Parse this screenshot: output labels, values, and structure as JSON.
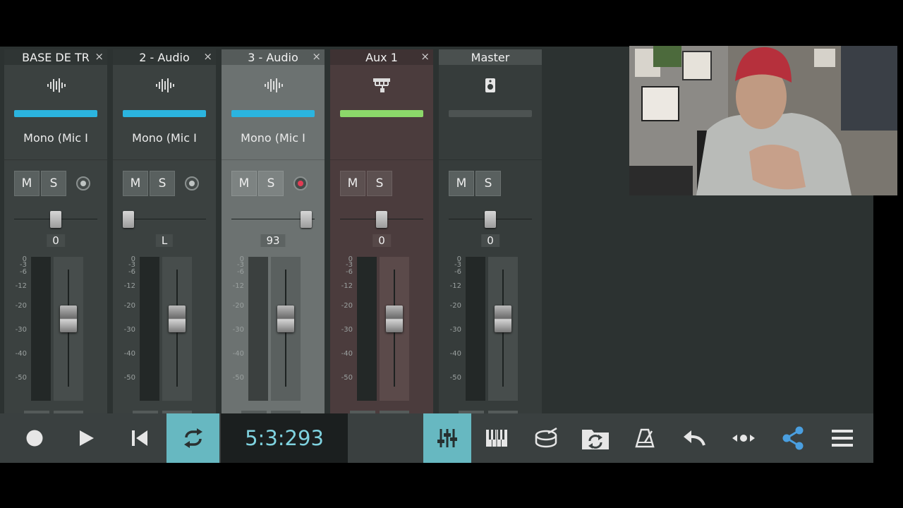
{
  "channels": [
    {
      "name": "BASE DE TR",
      "close": "×",
      "icon": "waveform-icon",
      "color": "#2bb4df",
      "input": "Mono (Mic I",
      "mute": "M",
      "solo": "S",
      "rec": "idle",
      "pan_label": "0",
      "pan_value": 0.5,
      "fader_db": 0
    },
    {
      "name": "2 - Audio",
      "close": "×",
      "icon": "waveform-icon",
      "color": "#2bb4df",
      "input": "Mono (Mic I",
      "mute": "M",
      "solo": "S",
      "rec": "idle",
      "pan_label": "L",
      "pan_value": 0.0,
      "fader_db": 0
    },
    {
      "name": "3 - Audio",
      "close": "×",
      "icon": "waveform-icon",
      "color": "#2bb4df",
      "input": "Mono (Mic I",
      "mute": "M",
      "solo": "S",
      "rec": "armed",
      "pan_label": "93",
      "pan_value": 0.965,
      "fader_db": 0
    },
    {
      "name": "Aux 1",
      "close": "×",
      "icon": "aux-bus-icon",
      "color": "#8cd86a",
      "mute": "M",
      "solo": "S",
      "pan_label": "0",
      "pan_value": 0.5,
      "fader_db": 0
    },
    {
      "name": "Master",
      "icon": "speaker-icon",
      "color": "#4d5352",
      "mute": "M",
      "solo": "S",
      "pan_label": "0",
      "pan_value": 0.5,
      "fader_db": 0
    }
  ],
  "meter_scale": [
    "0",
    "-3",
    "-6",
    "-12",
    "-20",
    "-30",
    "-40",
    "-50"
  ],
  "transport": {
    "time": "5:3:293",
    "record_icon": "record-icon",
    "play_icon": "play-icon",
    "rewind_icon": "skip-to-start-icon",
    "loop_icon": "loop-icon",
    "loop_active": true
  },
  "toolbar_right": [
    {
      "icon": "mixer-icon",
      "active": true
    },
    {
      "icon": "piano-keyboard-icon",
      "active": false
    },
    {
      "icon": "drum-icon",
      "active": false
    },
    {
      "icon": "sync-folder-icon",
      "active": false
    },
    {
      "icon": "metronome-icon",
      "active": false
    },
    {
      "icon": "undo-icon",
      "active": false
    },
    {
      "icon": "nudge-icon",
      "active": false
    },
    {
      "icon": "share-icon",
      "active": false
    },
    {
      "icon": "menu-icon",
      "active": false
    }
  ],
  "colors": {
    "accent": "#67b8c1",
    "time_text": "#7fd2df",
    "rec_armed": "#e23b54",
    "share": "#4a9fe0"
  }
}
